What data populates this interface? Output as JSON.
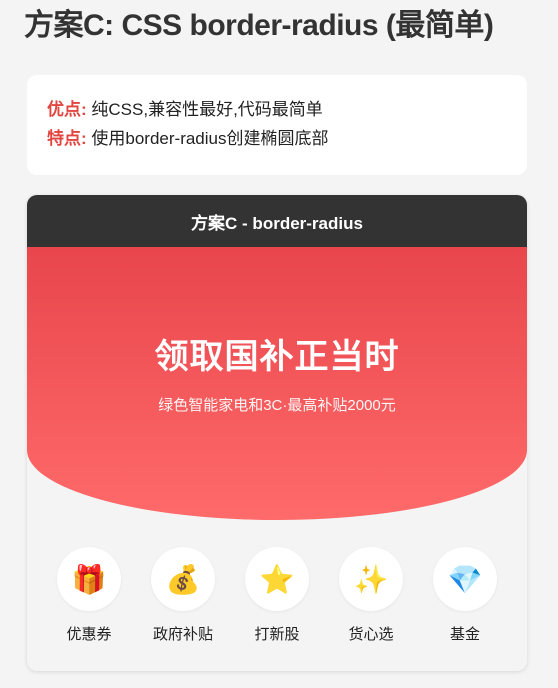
{
  "page": {
    "title": "方案C: CSS border-radius (最简单)"
  },
  "info": {
    "pros_key": "优点:",
    "pros_text": " 纯CSS,兼容性最好,代码最简单",
    "feature_key": "特点:",
    "feature_text": " 使用border-radius创建椭圆底部"
  },
  "demo": {
    "header": "方案C - border-radius",
    "hero_title": "领取国补正当时",
    "hero_subtitle": "绿色智能家电和3C·最高补贴2000元",
    "icons": [
      {
        "glyph": "🎁",
        "icon": "gift-icon",
        "label": "优惠券"
      },
      {
        "glyph": "💰",
        "icon": "money-bag-icon",
        "label": "政府补贴"
      },
      {
        "glyph": "⭐",
        "icon": "star-icon",
        "label": "打新股"
      },
      {
        "glyph": "✨",
        "icon": "sparkles-icon",
        "label": "货心选"
      },
      {
        "glyph": "💎",
        "icon": "diamond-icon",
        "label": "基金"
      }
    ]
  }
}
